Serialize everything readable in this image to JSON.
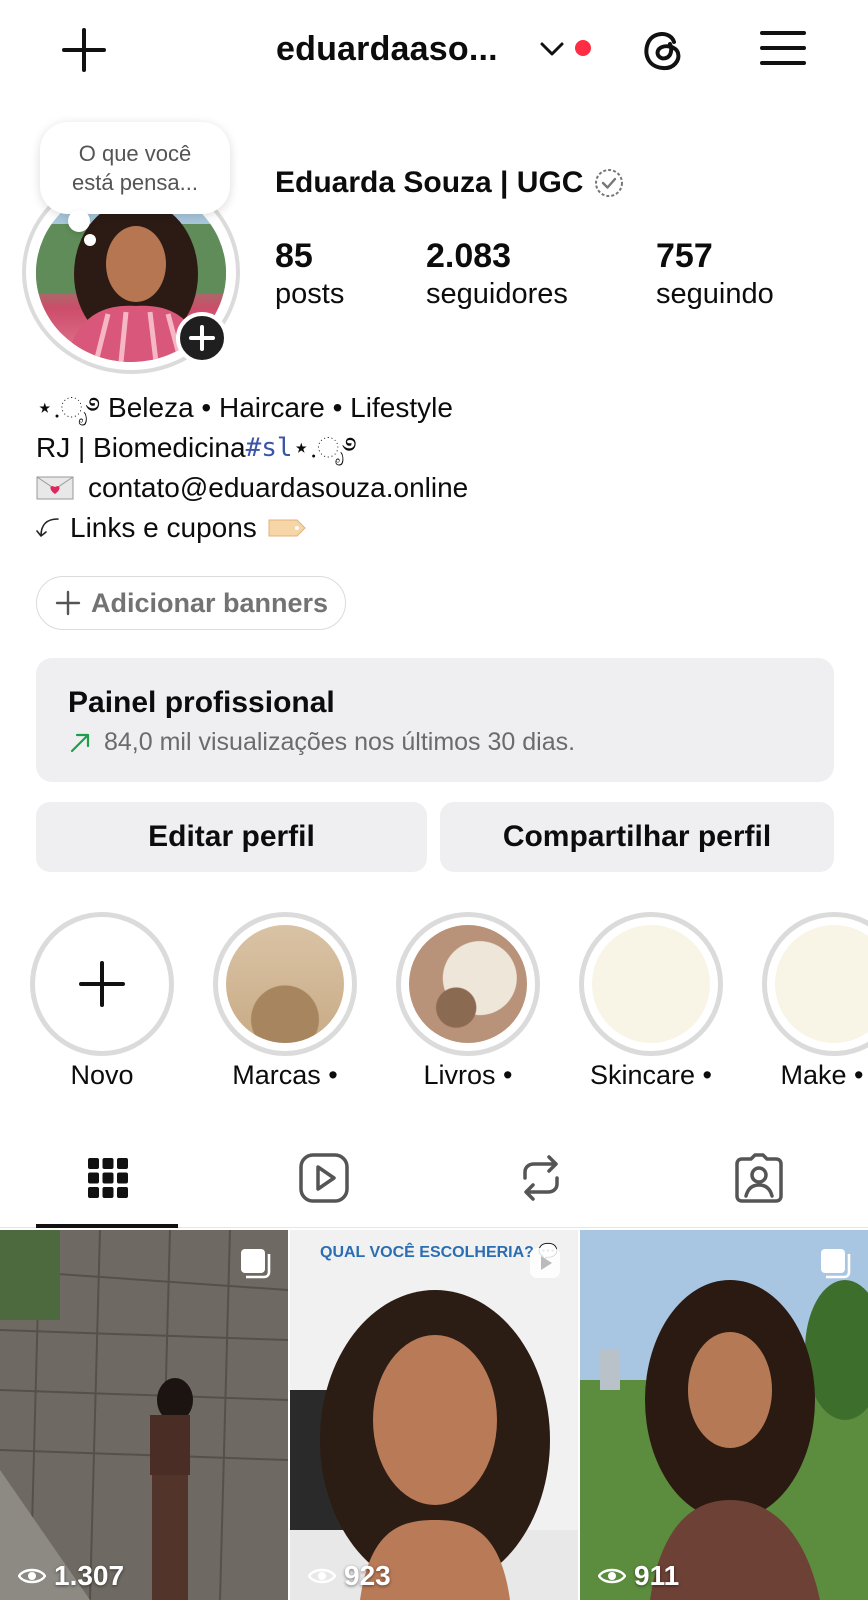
{
  "header": {
    "username": "eduardaaso...",
    "notification_color": "#ff2d44"
  },
  "profile": {
    "thought_bubble": "O que você está pensa...",
    "display_name": "Eduarda Souza | UGC",
    "stats": [
      {
        "value": "85",
        "label": "posts"
      },
      {
        "value": "2.083",
        "label": "seguidores"
      },
      {
        "value": "757",
        "label": "seguindo"
      }
    ],
    "bio": {
      "line1": "⋆.ೃ࿔ Beleza • Haircare • Lifestyle",
      "line2_prefix": "RJ | Biomedicina ",
      "line2_hashtag": "#sl",
      "line2_suffix": " ⋆.ೃ࿔",
      "line3": "contato@eduardasouza.online",
      "line4": "Links e cupons"
    }
  },
  "banners": {
    "label": "Adicionar banners"
  },
  "painel": {
    "title": "Painel profissional",
    "subtitle": "84,0 mil visualizações nos últimos 30 dias.",
    "trend_color": "#1e9e4a"
  },
  "actions": {
    "edit_label": "Editar perfil",
    "share_label": "Compartilhar perfil"
  },
  "highlights": [
    {
      "label": "Novo"
    },
    {
      "label": "Marcas •"
    },
    {
      "label": "Livros •"
    },
    {
      "label": "Skincare •"
    },
    {
      "label": "Make •"
    }
  ],
  "tabs": [
    "grid-icon",
    "reels-icon",
    "reposts-icon",
    "tagged-icon"
  ],
  "grid": [
    {
      "views": "1.307",
      "overlay": ""
    },
    {
      "views": "923",
      "overlay": "QUAL VOCÊ ESCOLHERIA? 💬"
    },
    {
      "views": "911",
      "overlay": ""
    }
  ]
}
